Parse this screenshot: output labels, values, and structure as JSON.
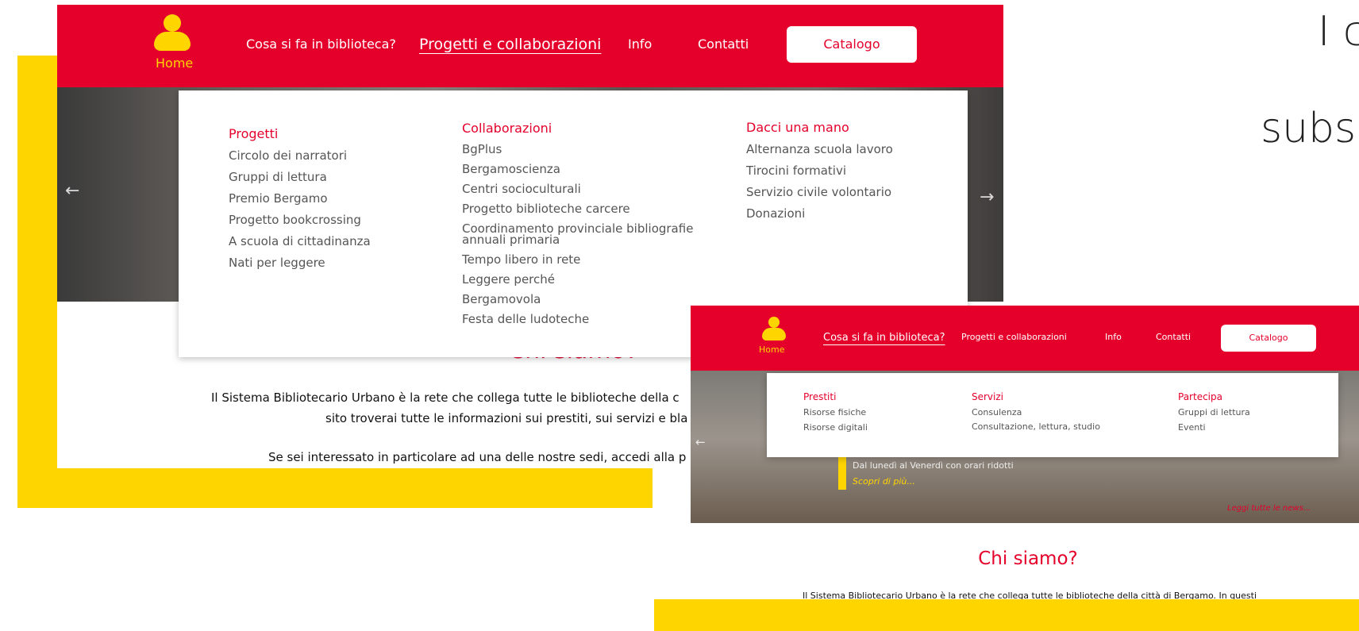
{
  "side_text": {
    "line1": "I c",
    "line2": "subse"
  },
  "large": {
    "logo_label": "Home",
    "nav": [
      "Cosa si fa in biblioteca?",
      "Progetti e collaborazioni",
      "Info",
      "Contatti"
    ],
    "catalog_label": "Catalogo",
    "dropdown": {
      "col1": {
        "title": "Progetti",
        "items": [
          "Circolo dei narratori",
          "Gruppi di lettura",
          "Premio Bergamo",
          "Progetto bookcrossing",
          "A scuola di cittadinanza",
          "Nati per leggere"
        ]
      },
      "col2": {
        "title": "Collaborazioni",
        "items": [
          "BgPlus",
          "Bergamoscienza",
          "Centri socioculturali",
          "Progetto biblioteche carcere",
          "Coordinamento provinciale bibliografie",
          "annuali primaria",
          "Tempo libero in rete",
          "Leggere perché",
          "Bergamovola",
          "Festa delle ludoteche"
        ]
      },
      "col3": {
        "title": "Dacci una mano",
        "items": [
          "Alternanza scuola lavoro",
          "Tirocini formativi",
          "Servizio civile volontario",
          "Donazioni"
        ]
      }
    },
    "heading": "Chi siamo?",
    "para1": "Il Sistema Bibliotecario Urbano è la rete che collega tutte le biblioteche della c",
    "para2": "sito troverai tutte le informazioni sui prestiti, sui servizi e bla",
    "para3": "Se sei interessato in particolare ad una delle nostre sedi, accedi alla p",
    "arrow_left": "←",
    "arrow_right": "→"
  },
  "small": {
    "logo_label": "Home",
    "nav": [
      "Cosa si fa in biblioteca?",
      "Progetti e collaborazioni",
      "Info",
      "Contatti"
    ],
    "catalog_label": "Catalogo",
    "dropdown": {
      "col1": {
        "title": "Prestiti",
        "items": [
          "Risorse fisiche",
          "Risorse digitali"
        ]
      },
      "col2": {
        "title": "Servizi",
        "items": [
          "Consulenza",
          "Consultazione, lettura, studio"
        ]
      },
      "col3": {
        "title": "Partecipa",
        "items": [
          "Gruppi di lettura",
          "Eventi"
        ]
      }
    },
    "slide_text": "Dal lunedì al Venerdì con orari ridotti",
    "slide_link": "Scopri di più...",
    "news_link": "Leggi tutte le news...",
    "heading": "Chi siamo?",
    "para1": "Il Sistema Bibliotecario Urbano è la rete che collega tutte le biblioteche della città di Bergamo. In questi",
    "arrow_left": "←"
  }
}
